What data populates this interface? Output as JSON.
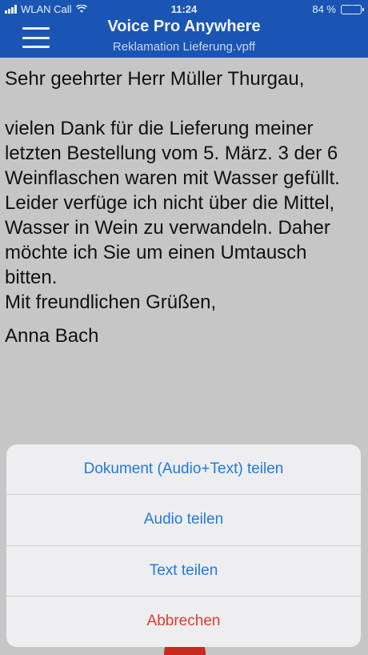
{
  "status_bar": {
    "carrier": "WLAN Call",
    "time": "11:24",
    "battery": "84 %",
    "battery_level": 0.84
  },
  "header": {
    "app_title": "Voice Pro Anywhere",
    "document_name": "Reklamation Lieferung.vpff"
  },
  "document": {
    "greeting": "Sehr geehrter Herr Müller Thurgau,",
    "body": "vielen Dank für die Lieferung meiner letzten Bestellung vom 5. März. 3 der 6 Weinflaschen waren mit Wasser gefüllt. Leider verfüge ich nicht über die Mittel, Wasser in Wein zu verwandeln. Daher möchte ich Sie um einen Umtausch bitten.",
    "closing": "Mit freundlichen Grüßen,",
    "signature": "Anna Bach"
  },
  "action_sheet": {
    "share_document": "Dokument (Audio+Text) teilen",
    "share_audio": "Audio teilen",
    "share_text": "Text teilen",
    "cancel": "Abbrechen"
  },
  "colors": {
    "header_bg": "#1a55b4",
    "action_blue": "#1f7ae3",
    "cancel_red": "#e5392f",
    "record_red": "#c62a1f"
  }
}
